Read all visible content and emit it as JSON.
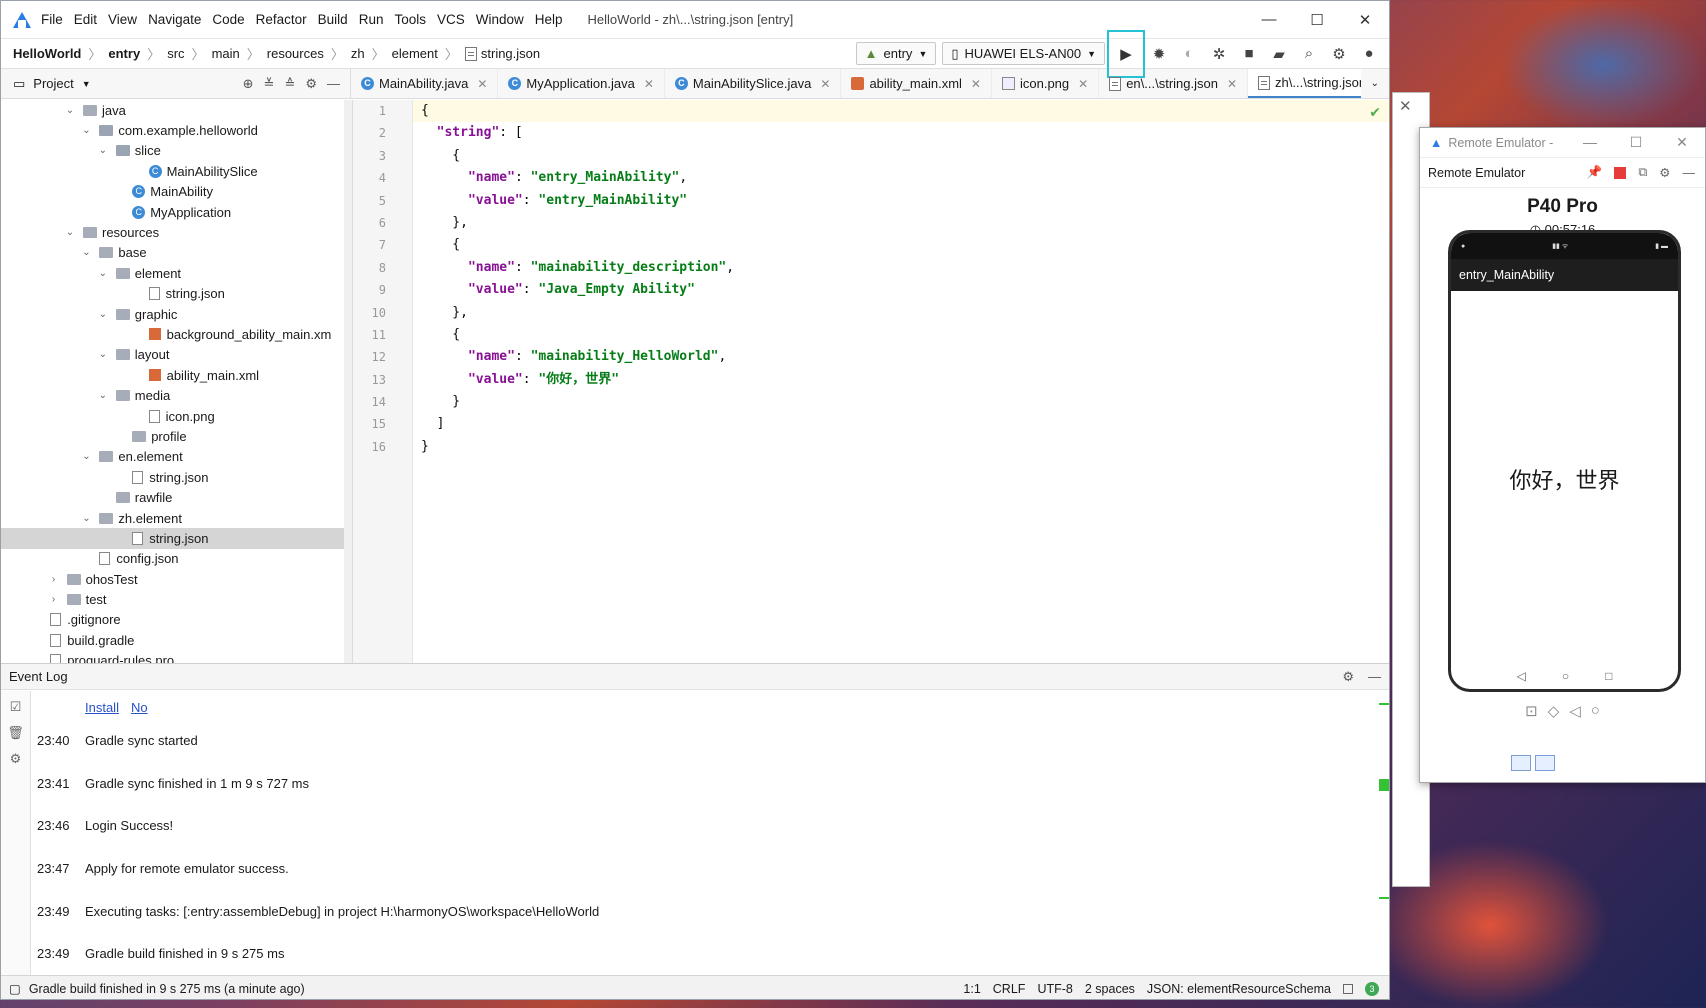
{
  "window": {
    "title": "HelloWorld - zh\\...\\string.json [entry]"
  },
  "menu": [
    "File",
    "Edit",
    "View",
    "Navigate",
    "Code",
    "Refactor",
    "Build",
    "Run",
    "Tools",
    "VCS",
    "Window",
    "Help"
  ],
  "breadcrumb": [
    "HelloWorld",
    "entry",
    "src",
    "main",
    "resources",
    "zh",
    "element",
    "string.json"
  ],
  "run": {
    "config": "entry",
    "device": "HUAWEI ELS-AN00"
  },
  "project_panel": {
    "label": "Project"
  },
  "tabs": [
    {
      "label": "MainAbility.java",
      "icon": "class-icon"
    },
    {
      "label": "MyApplication.java",
      "icon": "class-icon"
    },
    {
      "label": "MainAbilitySlice.java",
      "icon": "class-icon"
    },
    {
      "label": "ability_main.xml",
      "icon": "xml-icon"
    },
    {
      "label": "icon.png",
      "icon": "image-icon"
    },
    {
      "label": "en\\...\\string.json",
      "icon": "json-icon"
    },
    {
      "label": "zh\\...\\string.json",
      "icon": "json-icon",
      "active": true
    }
  ],
  "tree": [
    {
      "label": "java",
      "indent": 5,
      "arrow": "v",
      "type": "folder"
    },
    {
      "label": "com.example.helloworld",
      "indent": 6,
      "arrow": "v",
      "type": "pkg"
    },
    {
      "label": "slice",
      "indent": 7,
      "arrow": "v",
      "type": "pkg"
    },
    {
      "label": "MainAbilitySlice",
      "indent": 9,
      "arrow": "",
      "type": "class"
    },
    {
      "label": "MainAbility",
      "indent": 8,
      "arrow": "",
      "type": "class"
    },
    {
      "label": "MyApplication",
      "indent": 8,
      "arrow": "",
      "type": "class"
    },
    {
      "label": "resources",
      "indent": 5,
      "arrow": "v",
      "type": "folder"
    },
    {
      "label": "base",
      "indent": 6,
      "arrow": "v",
      "type": "folder"
    },
    {
      "label": "element",
      "indent": 7,
      "arrow": "v",
      "type": "folder"
    },
    {
      "label": "string.json",
      "indent": 9,
      "arrow": "",
      "type": "file"
    },
    {
      "label": "graphic",
      "indent": 7,
      "arrow": "v",
      "type": "folder"
    },
    {
      "label": "background_ability_main.xm",
      "indent": 9,
      "arrow": "",
      "type": "xml"
    },
    {
      "label": "layout",
      "indent": 7,
      "arrow": "v",
      "type": "folder"
    },
    {
      "label": "ability_main.xml",
      "indent": 9,
      "arrow": "",
      "type": "xml"
    },
    {
      "label": "media",
      "indent": 7,
      "arrow": "v",
      "type": "folder"
    },
    {
      "label": "icon.png",
      "indent": 9,
      "arrow": "",
      "type": "file"
    },
    {
      "label": "profile",
      "indent": 8,
      "arrow": "",
      "type": "folder"
    },
    {
      "label": "en.element",
      "indent": 6,
      "arrow": "v",
      "type": "folder"
    },
    {
      "label": "string.json",
      "indent": 8,
      "arrow": "",
      "type": "file"
    },
    {
      "label": "rawfile",
      "indent": 7,
      "arrow": "",
      "type": "folder"
    },
    {
      "label": "zh.element",
      "indent": 6,
      "arrow": "v",
      "type": "folder"
    },
    {
      "label": "string.json",
      "indent": 8,
      "arrow": "",
      "type": "file",
      "selected": true
    },
    {
      "label": "config.json",
      "indent": 6,
      "arrow": "",
      "type": "file"
    },
    {
      "label": "ohosTest",
      "indent": 4,
      "arrow": ">",
      "type": "folder"
    },
    {
      "label": "test",
      "indent": 4,
      "arrow": ">",
      "type": "folder"
    },
    {
      "label": ".gitignore",
      "indent": 3,
      "arrow": "",
      "type": "file"
    },
    {
      "label": "build.gradle",
      "indent": 3,
      "arrow": "",
      "type": "file"
    },
    {
      "label": "proguard-rules.pro",
      "indent": 3,
      "arrow": "",
      "type": "file"
    }
  ],
  "code": [
    [
      [
        "p",
        "{"
      ]
    ],
    [
      [
        "p",
        "  "
      ],
      [
        "k",
        "\"string\""
      ],
      [
        "p",
        ": ["
      ]
    ],
    [
      [
        "p",
        "    {"
      ]
    ],
    [
      [
        "p",
        "      "
      ],
      [
        "k",
        "\"name\""
      ],
      [
        "p",
        ": "
      ],
      [
        "s",
        "\"entry_MainAbility\""
      ],
      [
        "p",
        ","
      ]
    ],
    [
      [
        "p",
        "      "
      ],
      [
        "k",
        "\"value\""
      ],
      [
        "p",
        ": "
      ],
      [
        "s",
        "\"entry_MainAbility\""
      ]
    ],
    [
      [
        "p",
        "    },"
      ]
    ],
    [
      [
        "p",
        "    {"
      ]
    ],
    [
      [
        "p",
        "      "
      ],
      [
        "k",
        "\"name\""
      ],
      [
        "p",
        ": "
      ],
      [
        "s",
        "\"mainability_description\""
      ],
      [
        "p",
        ","
      ]
    ],
    [
      [
        "p",
        "      "
      ],
      [
        "k",
        "\"value\""
      ],
      [
        "p",
        ": "
      ],
      [
        "s",
        "\"Java_Empty Ability\""
      ]
    ],
    [
      [
        "p",
        "    },"
      ]
    ],
    [
      [
        "p",
        "    {"
      ]
    ],
    [
      [
        "p",
        "      "
      ],
      [
        "k",
        "\"name\""
      ],
      [
        "p",
        ": "
      ],
      [
        "s",
        "\"mainability_HelloWorld\""
      ],
      [
        "p",
        ","
      ]
    ],
    [
      [
        "p",
        "      "
      ],
      [
        "k",
        "\"value\""
      ],
      [
        "p",
        ": "
      ],
      [
        "s",
        "\"你好，世界\""
      ]
    ],
    [
      [
        "p",
        "    }"
      ]
    ],
    [
      [
        "p",
        "  ]"
      ]
    ],
    [
      [
        "p",
        "}"
      ]
    ]
  ],
  "event_log": {
    "title": "Event Log",
    "links": [
      "Install",
      "No"
    ],
    "entries": [
      {
        "time": "23:40",
        "text": "Gradle sync started"
      },
      {
        "time": "23:41",
        "text": "Gradle sync finished in 1 m 9 s 727 ms"
      },
      {
        "time": "23:46",
        "text": "Login Success!"
      },
      {
        "time": "23:47",
        "text": "Apply for remote emulator success."
      },
      {
        "time": "23:49",
        "text": "Executing tasks: [:entry:assembleDebug] in project H:\\harmonyOS\\workspace\\HelloWorld"
      },
      {
        "time": "23:49",
        "text": "Gradle build finished in 9 s 275 ms"
      }
    ]
  },
  "status": {
    "message": "Gradle build finished in 9 s 275 ms (a minute ago)",
    "position": "1:1",
    "line_sep": "CRLF",
    "encoding": "UTF-8",
    "indent": "2 spaces",
    "schema": "JSON: elementResourceSchema"
  },
  "emulator": {
    "window_title": "Remote Emulator -",
    "panel_title": "Remote Emulator",
    "model": "P40 Pro",
    "timer": "00:57:16",
    "app_title": "entry_MainAbility",
    "content": "你好，世界"
  },
  "colors": {
    "accent": "#2a7de1",
    "run_highlight": "#27c1d6",
    "keyword": "#871094",
    "string": "#067d17"
  }
}
